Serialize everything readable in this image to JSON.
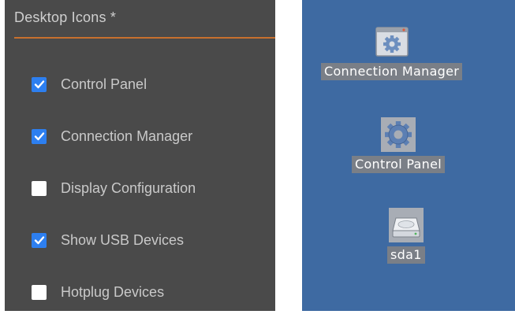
{
  "panel": {
    "title": "Desktop Icons *",
    "accent_color": "#c8702e",
    "options": [
      {
        "label": "Control Panel",
        "checked": true
      },
      {
        "label": "Connection Manager",
        "checked": true
      },
      {
        "label": "Display Configuration",
        "checked": false
      },
      {
        "label": "Show USB Devices",
        "checked": true
      },
      {
        "label": "Hotplug Devices",
        "checked": false
      }
    ]
  },
  "desktop": {
    "background_color": "#3e6aa2",
    "icons": [
      {
        "label": "Connection Manager",
        "icon": "window-gear-icon"
      },
      {
        "label": "Control Panel",
        "icon": "gear-icon"
      },
      {
        "label": "sda1",
        "icon": "drive-icon"
      }
    ]
  }
}
